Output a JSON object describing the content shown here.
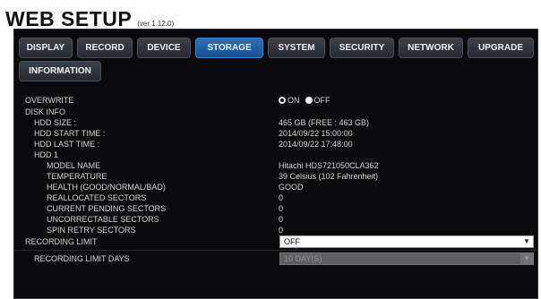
{
  "header": {
    "title": "WEB SETUP",
    "version": "(ver 1.12.0)"
  },
  "tabs": [
    {
      "label": "DISPLAY"
    },
    {
      "label": "RECORD"
    },
    {
      "label": "DEVICE"
    },
    {
      "label": "STORAGE"
    },
    {
      "label": "SYSTEM"
    },
    {
      "label": "SECURITY"
    },
    {
      "label": "NETWORK"
    },
    {
      "label": "UPGRADE"
    },
    {
      "label": "INFORMATION"
    }
  ],
  "active_tab": "STORAGE",
  "storage": {
    "overwrite": {
      "label": "OVERWRITE",
      "on_label": "ON",
      "off_label": "OFF",
      "selected": "OFF"
    },
    "disk_info": {
      "label": "DISK INFO",
      "hdd_size": {
        "label": "HDD SIZE :",
        "value": "465 GB (FREE : 463 GB)"
      },
      "hdd_start_time": {
        "label": "HDD START TIME :",
        "value": "2014/09/22 15:00:00"
      },
      "hdd_last_time": {
        "label": "HDD LAST TIME :",
        "value": "2014/09/22 17:48:00"
      },
      "hdd1": {
        "label": "HDD 1",
        "model_name": {
          "label": "MODEL NAME",
          "value": "Hitachi HDS721050CLA362"
        },
        "temperature": {
          "label": "TEMPERATURE",
          "value": "39 Celsius (102 Fahrenheit)"
        },
        "health": {
          "label": "HEALTH (GOOD/NORMAL/BAD)",
          "value": "GOOD"
        },
        "reallocated_sectors": {
          "label": "REALLOCATED SECTORS",
          "value": "0"
        },
        "current_pending_sectors": {
          "label": "CURRENT PENDING SECTORS",
          "value": "0"
        },
        "uncorrectable_sectors": {
          "label": "UNCORRECTABLE SECTORS",
          "value": "0"
        },
        "spin_retry_sectors": {
          "label": "SPIN RETRY SECTORS",
          "value": "0"
        }
      }
    },
    "recording_limit": {
      "label": "RECORDING LIMIT",
      "value": "OFF"
    },
    "recording_limit_days": {
      "label": "RECORDING LIMIT DAYS",
      "value": "10 DAY(S)",
      "disabled": true
    }
  },
  "colors": {
    "panel_bg": "#0a0a0c",
    "tab_bg": "#2f3239",
    "tab_active": "#1f5da3",
    "text": "#d6d6d6"
  }
}
